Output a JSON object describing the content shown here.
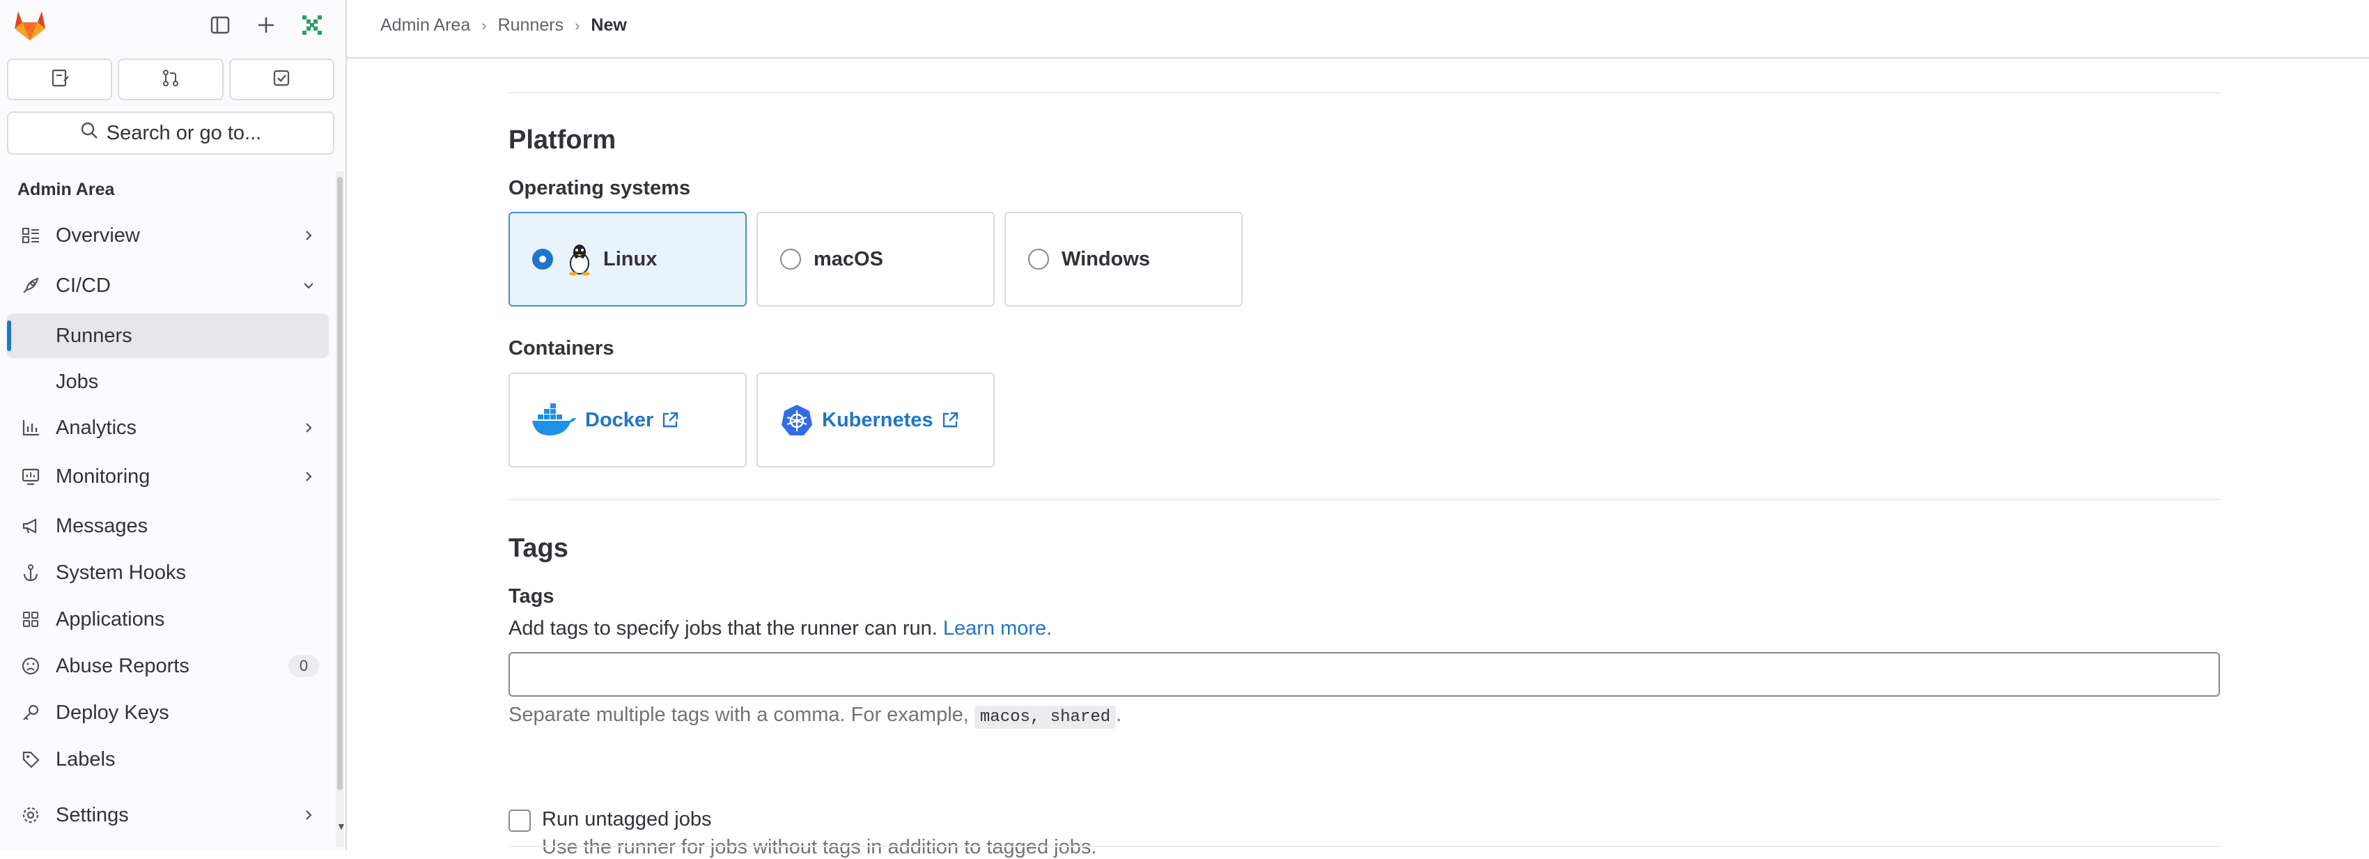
{
  "sidebar": {
    "section_title": "Admin Area",
    "search_label": "Search or go to...",
    "items": [
      {
        "label": "Overview",
        "icon": "overview-icon"
      },
      {
        "label": "CI/CD",
        "icon": "rocket-icon"
      },
      {
        "label": "Runners"
      },
      {
        "label": "Jobs"
      },
      {
        "label": "Analytics",
        "icon": "chart-icon"
      },
      {
        "label": "Monitoring",
        "icon": "monitor-icon"
      },
      {
        "label": "Messages",
        "icon": "megaphone-icon"
      },
      {
        "label": "System Hooks",
        "icon": "anchor-icon"
      },
      {
        "label": "Applications",
        "icon": "apps-icon"
      },
      {
        "label": "Abuse Reports",
        "icon": "abuse-icon",
        "badge": "0"
      },
      {
        "label": "Deploy Keys",
        "icon": "key-icon"
      },
      {
        "label": "Labels",
        "icon": "label-icon"
      },
      {
        "label": "Settings",
        "icon": "gear-icon"
      }
    ]
  },
  "breadcrumb": {
    "items": [
      "Admin Area",
      "Runners",
      "New"
    ]
  },
  "platform": {
    "title": "Platform",
    "os_label": "Operating systems",
    "os_options": [
      {
        "label": "Linux",
        "selected": true
      },
      {
        "label": "macOS",
        "selected": false
      },
      {
        "label": "Windows",
        "selected": false
      }
    ],
    "containers_label": "Containers",
    "containers": [
      {
        "label": "Docker"
      },
      {
        "label": "Kubernetes"
      }
    ]
  },
  "tags": {
    "title": "Tags",
    "field_label": "Tags",
    "description": "Add tags to specify jobs that the runner can run.",
    "learn_more": "Learn more.",
    "input_value": "",
    "hint_prefix": "Separate multiple tags with a comma. For example,",
    "hint_example": "macos, shared",
    "hint_suffix": ".",
    "untagged_label": "Run untagged jobs",
    "untagged_help": "Use the runner for jobs without tags in addition to tagged jobs.",
    "untagged_checked": false
  },
  "colors": {
    "accent": "#1f75cb",
    "selected_bg": "#e9f3fc",
    "sidebar_bg": "#fbfafd"
  }
}
